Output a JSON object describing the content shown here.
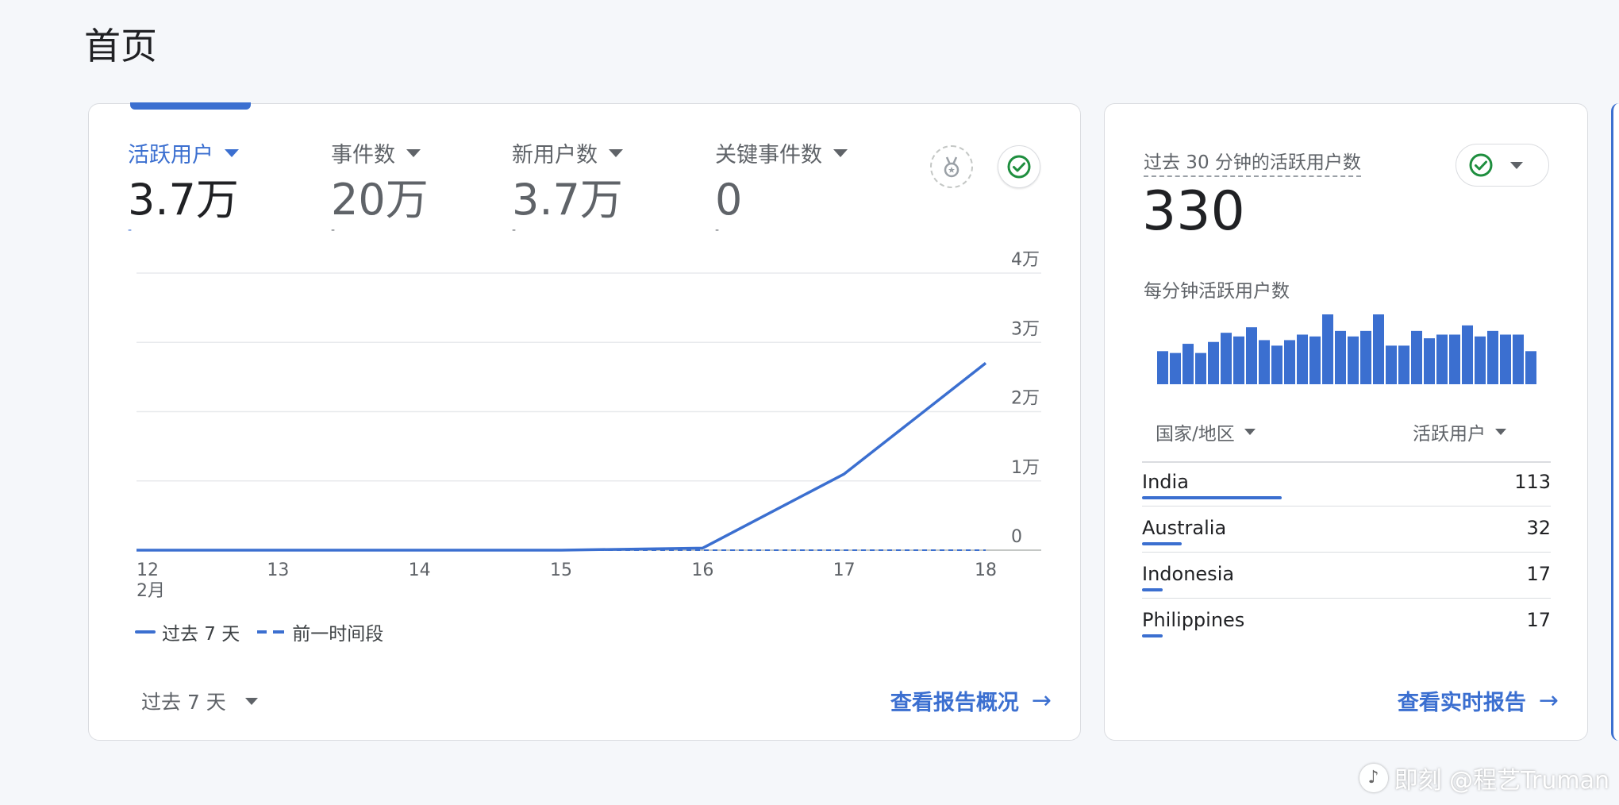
{
  "page": {
    "title": "首页"
  },
  "main_card": {
    "metrics": [
      {
        "label": "活跃用户",
        "value": "3.7万",
        "delta": "-",
        "active": true
      },
      {
        "label": "事件数",
        "value": "20万",
        "delta": "-"
      },
      {
        "label": "新用户数",
        "value": "3.7万",
        "delta": "-"
      },
      {
        "label": "关键事件数",
        "value": "0",
        "delta": "-"
      }
    ],
    "icons": {
      "medal": "medal-icon",
      "check": "check-circle-icon"
    },
    "legend": {
      "current": "过去 7 天",
      "previous": "前一时间段"
    },
    "range_select": "过去 7 天",
    "link": "查看报告概况",
    "colors": {
      "accent": "#3b6fd0",
      "check_green": "#1e8e3e"
    }
  },
  "chart_data": {
    "type": "line",
    "x": [
      "12",
      "13",
      "14",
      "15",
      "16",
      "17",
      "18"
    ],
    "x_sublabel": "2月",
    "ytick_labels": [
      "0",
      "1万",
      "2万",
      "3万",
      "4万"
    ],
    "yticks": [
      0,
      10000,
      20000,
      30000,
      40000
    ],
    "ylim": [
      0,
      40000
    ],
    "series": [
      {
        "name": "过去 7 天",
        "values": [
          0,
          0,
          0,
          0,
          300,
          11000,
          27000
        ],
        "style": "solid"
      },
      {
        "name": "前一时间段",
        "values": [
          0,
          0,
          0,
          0,
          0,
          0,
          0
        ],
        "style": "dashed"
      }
    ],
    "grid": true,
    "legend_position": "bottom-left"
  },
  "realtime_card": {
    "title": "过去 30 分钟的活跃用户数",
    "value": "330",
    "subtitle": "每分钟活跃用户数",
    "per_minute": [
      9,
      8.5,
      11,
      8.5,
      11.5,
      14,
      13,
      15.5,
      12,
      10.5,
      12,
      13.5,
      13,
      19,
      14.5,
      13,
      14.5,
      19,
      10.5,
      10.5,
      14.5,
      12.5,
      13.5,
      13.5,
      16,
      13,
      14.5,
      13.5,
      13.5,
      9
    ],
    "columns": {
      "country": "国家/地区",
      "users": "活跃用户"
    },
    "rows": [
      {
        "country": "India",
        "count": "113",
        "share": 1.0
      },
      {
        "country": "Australia",
        "count": "32",
        "share": 0.283
      },
      {
        "country": "Indonesia",
        "count": "17",
        "share": 0.15
      },
      {
        "country": "Philippines",
        "count": "17",
        "share": 0.15
      }
    ],
    "link": "查看实时报告"
  },
  "watermark": {
    "text": "即刻 @程艺Truman"
  }
}
